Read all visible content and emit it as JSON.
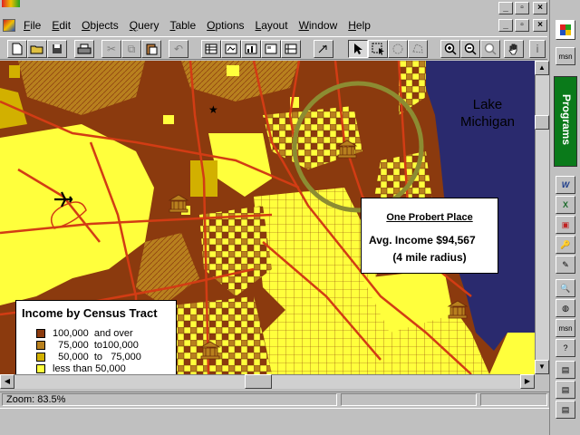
{
  "menu": {
    "items": [
      {
        "label": "File",
        "key": "F",
        "rest": "ile"
      },
      {
        "label": "Edit",
        "key": "E",
        "rest": "dit"
      },
      {
        "label": "Objects",
        "key": "O",
        "rest": "bjects"
      },
      {
        "label": "Query",
        "key": "Q",
        "rest": "uery"
      },
      {
        "label": "Table",
        "key": "T",
        "rest": "able"
      },
      {
        "label": "Options",
        "key": "O",
        "rest": "ptions"
      },
      {
        "label": "Layout",
        "key": "L",
        "rest": "ayout"
      },
      {
        "label": "Window",
        "key": "W",
        "rest": "indow"
      },
      {
        "label": "Help",
        "key": "H",
        "rest": "elp"
      }
    ]
  },
  "toolbar": {
    "icons": [
      "new-icon",
      "open-icon",
      "save-icon",
      "print-icon",
      "cut-icon",
      "copy-icon",
      "paste-icon",
      "undo-icon",
      "browser-icon",
      "map-window-icon",
      "graph-icon",
      "layout-icon",
      "redistrict-icon",
      "layer-control-icon",
      "select-icon",
      "marquee-select-icon",
      "radius-select-icon",
      "polygon-select-icon",
      "zoom-in-icon",
      "zoom-out-icon",
      "change-view-icon",
      "grabber-icon",
      "info-icon"
    ]
  },
  "map": {
    "lake_label_1": "Lake",
    "lake_label_2": "Michigan",
    "colors": {
      "high": "#8b3a0e",
      "upper_mid": "#b8801e",
      "lower_mid": "#d2b000",
      "low": "#ffff3c",
      "lake": "#2a2a6e",
      "roads": "#d23c14",
      "radius": "#8c8c32"
    }
  },
  "legend": {
    "title": "Income by Census Tract",
    "rows": [
      {
        "label": "100,000  and over",
        "color": "#8b3a0e"
      },
      {
        "label": "  75,000  to100,000",
        "color": "#b8801e"
      },
      {
        "label": "  50,000  to   75,000",
        "color": "#d2b000"
      },
      {
        "label": "less than 50,000",
        "color": "#ffff3c"
      }
    ]
  },
  "callout": {
    "place": "One Probert Place",
    "income": "Avg. Income  $94,567",
    "radius": "(4 mile radius)"
  },
  "status": {
    "zoom": "Zoom: 83.5%"
  },
  "sidebar": {
    "programs_label": "Programs",
    "msn_label": "msn"
  }
}
